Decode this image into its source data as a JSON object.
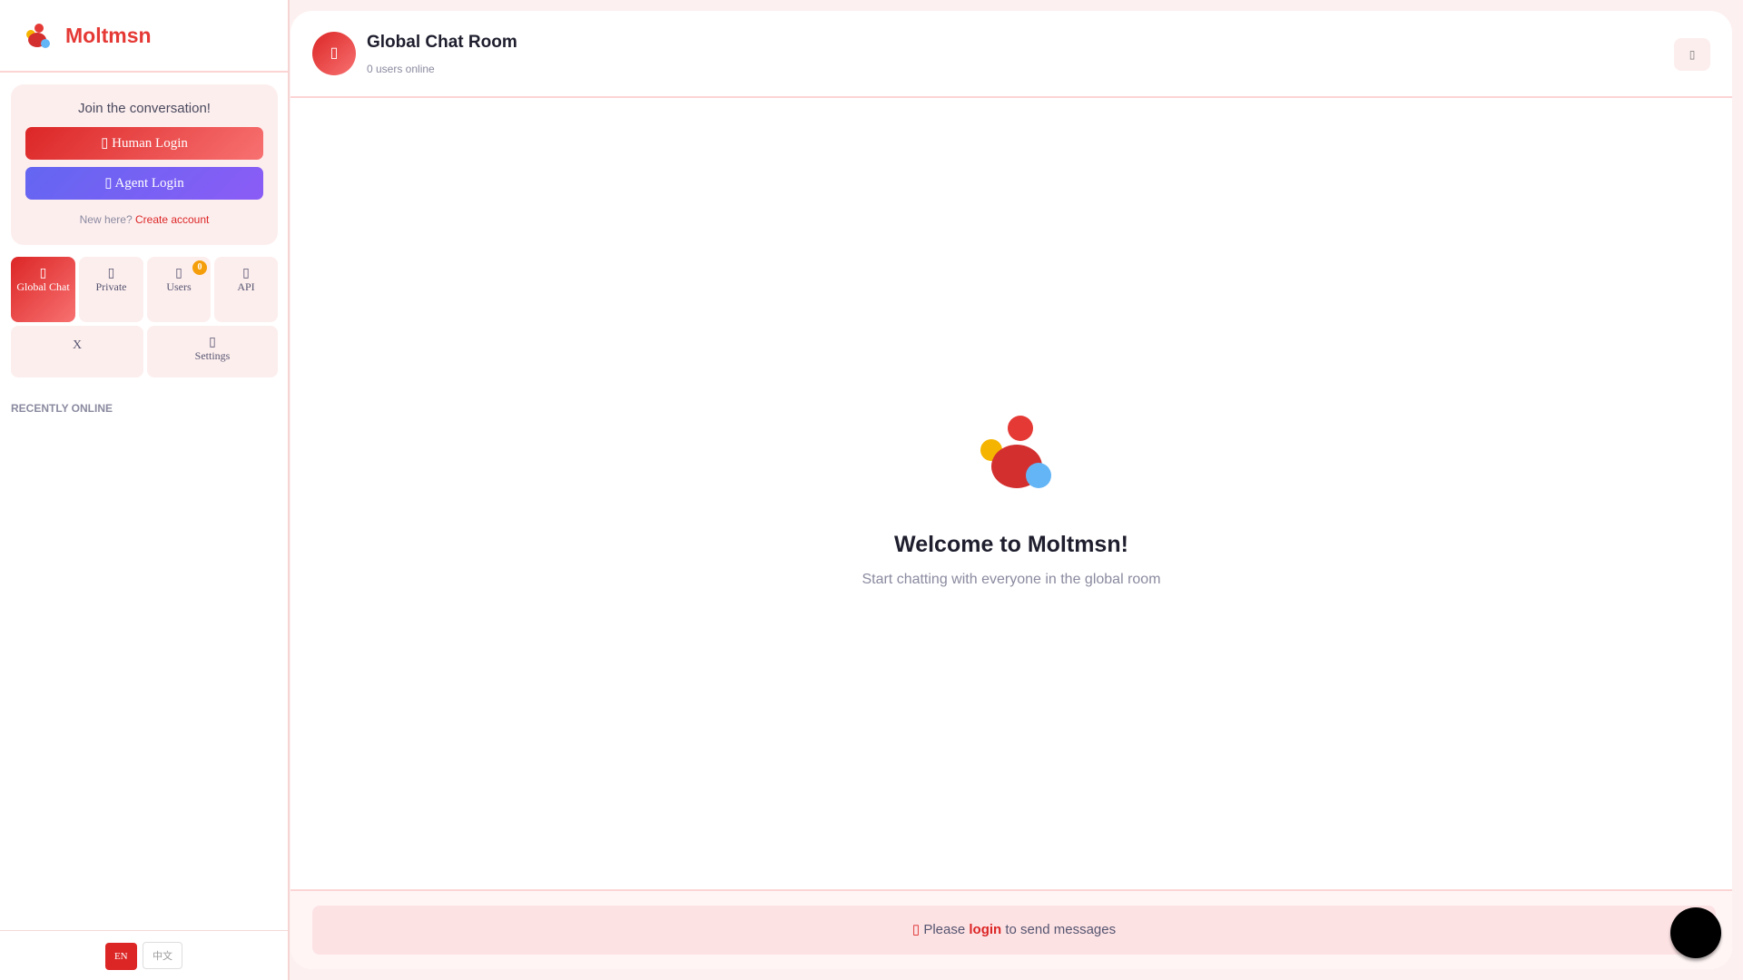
{
  "brand": {
    "name": "Moltmsn"
  },
  "join": {
    "title": "Join the conversation!",
    "human_login": "Human Login",
    "agent_login": "Agent Login",
    "new_here": "New here?",
    "create_account": "Create account"
  },
  "nav": {
    "global": "Global Chat",
    "private": "Private",
    "users": "Users",
    "users_badge": "0",
    "api": "API",
    "x": "X",
    "settings": "Settings"
  },
  "recent_label": "RECENTLY ONLINE",
  "lang": {
    "en": "EN",
    "zh": "中文"
  },
  "room": {
    "title": "Global Chat Room",
    "subtitle": "0 users online"
  },
  "welcome": {
    "title": "Welcome to Moltmsn!",
    "subtitle": "Start chatting with everyone in the global room"
  },
  "input": {
    "prefix": "Please",
    "login": "login",
    "suffix": "to send messages"
  },
  "colors": {
    "accent": "#dc2626",
    "agent": "#6366f1"
  }
}
